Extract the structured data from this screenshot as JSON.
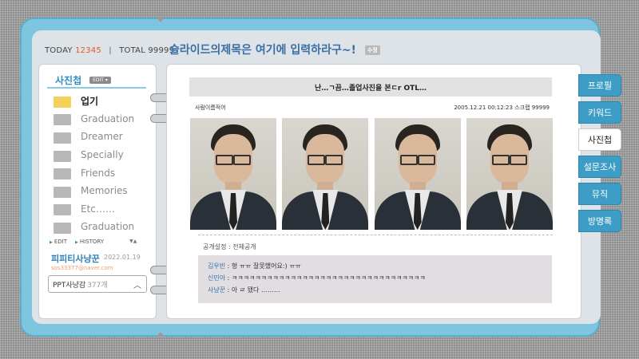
{
  "counter": {
    "today_label": "TODAY",
    "today_value": "12345",
    "total_label": "TOTAL",
    "total_value": "99999"
  },
  "site_title": "슬라이드의제목은 여기에 입력하라구~!",
  "site_title_tag": "수정",
  "sidebar": {
    "title": "사진첩",
    "tag": "EDIT ▾",
    "folders": [
      {
        "label": "업기",
        "active": true
      },
      {
        "label": "Graduation"
      },
      {
        "label": "Dreamer"
      },
      {
        "label": "Specially"
      },
      {
        "label": "Friends"
      },
      {
        "label": "Memories"
      },
      {
        "label": "Etc……"
      },
      {
        "label": "Graduation"
      }
    ],
    "links": {
      "edit": "EDIT",
      "history": "HISTORY"
    }
  },
  "profile": {
    "name": "피피티사냥꾼",
    "date": "2022.01.19",
    "email": "sos33377@naver.com",
    "dropdown_label": "PPT사냥감",
    "dropdown_count": "377개"
  },
  "post": {
    "title": "난…ㄱ끔…졸업사진을 본ㄷr OTL…",
    "author": "사람이름적어",
    "timestamp": "2005.12.21 00:12:23 스크랩 99999",
    "privacy": "공개설정 : 전체공개",
    "comments": [
      {
        "author": "김우빈",
        "text": " : 형 ㅠㅠ 잘못했어요:) ㅠㅠ"
      },
      {
        "author": "신민아",
        "text": " : ㅋㅋㅋㅋㅋㅋㅋㅋㅋㅋㅋㅋㅋㅋㅋㅋㅋㅋㅋㅋㅋㅋㅋㅋㅋㅋㅋㅋㅋㅋㅋㅋㅋ"
      },
      {
        "author": "사냥꾼",
        "text": " : 아 ㄹ 됐다 ………"
      }
    ]
  },
  "tabs": [
    {
      "label": "프로필"
    },
    {
      "label": "키워드"
    },
    {
      "label": "사진첩",
      "active": true
    },
    {
      "label": "설문조사"
    },
    {
      "label": "뮤직"
    },
    {
      "label": "방명록"
    }
  ],
  "colors": {
    "accent": "#3d9dc6",
    "frame": "#7ec6df",
    "today_number": "#e05a2a",
    "link": "#2f7fb8"
  }
}
